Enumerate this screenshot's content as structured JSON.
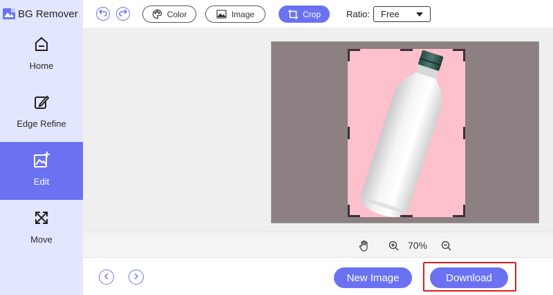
{
  "app": {
    "title": "BG Remover"
  },
  "sidebar": {
    "items": [
      {
        "label": "Home",
        "icon": "home-icon",
        "active": false
      },
      {
        "label": "Edge Refine",
        "icon": "edge-refine-icon",
        "active": false
      },
      {
        "label": "Edit",
        "icon": "edit-image-icon",
        "active": true
      },
      {
        "label": "Move",
        "icon": "move-icon",
        "active": false
      }
    ]
  },
  "toolbar": {
    "undo_icon": "undo-icon",
    "redo_icon": "redo-icon",
    "color_label": "Color",
    "image_label": "Image",
    "crop_label": "Crop",
    "ratio_label": "Ratio:",
    "ratio_value": "Free"
  },
  "zoom": {
    "value": "70%"
  },
  "bottom": {
    "new_image_label": "New Image",
    "download_label": "Download"
  },
  "colors": {
    "accent": "#6b72f2",
    "sidebar_bg": "#e3e6ff",
    "background_fill": "#fdc0cc",
    "outside_crop": "#8c8082",
    "highlight": "#e01b1b"
  }
}
